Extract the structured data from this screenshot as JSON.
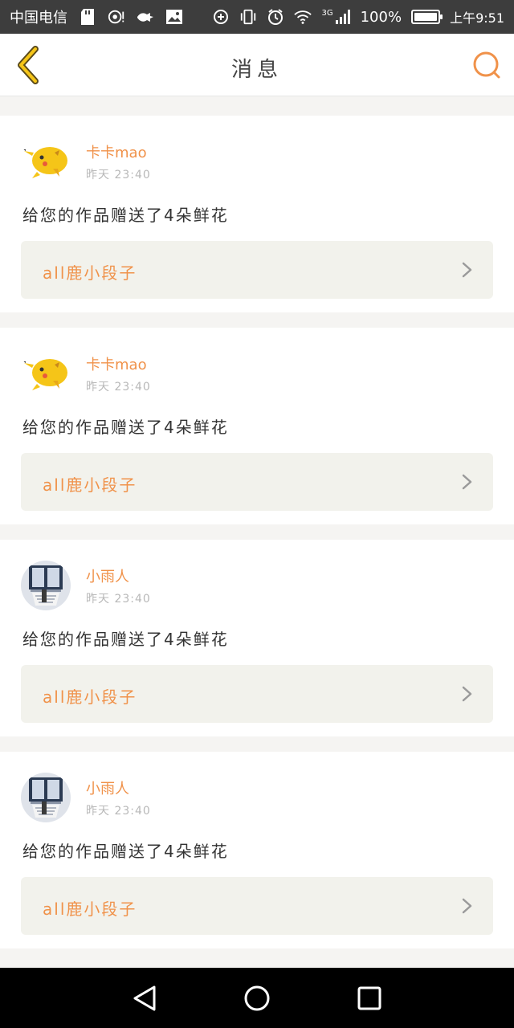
{
  "status_bar": {
    "carrier": "中国电信",
    "battery_percent": "100%",
    "battery_level": 1.0,
    "network": "3G",
    "time": "上午9:51"
  },
  "header": {
    "title": "消息",
    "accent_color": "#f0924a"
  },
  "messages": [
    {
      "username": "卡卡mao",
      "time": "昨天 23:40",
      "text": "给您的作品赠送了4朵鲜花",
      "work_title": "all鹿小段子",
      "avatar": "pikachu-avatar"
    },
    {
      "username": "卡卡mao",
      "time": "昨天 23:40",
      "text": "给您的作品赠送了4朵鲜花",
      "work_title": "all鹿小段子",
      "avatar": "pikachu-avatar"
    },
    {
      "username": "小雨人",
      "time": "昨天 23:40",
      "text": "给您的作品赠送了4朵鲜花",
      "work_title": "all鹿小段子",
      "avatar": "window-avatar"
    },
    {
      "username": "小雨人",
      "time": "昨天 23:40",
      "text": "给您的作品赠送了4朵鲜花",
      "work_title": "all鹿小段子",
      "avatar": "window-avatar"
    }
  ]
}
